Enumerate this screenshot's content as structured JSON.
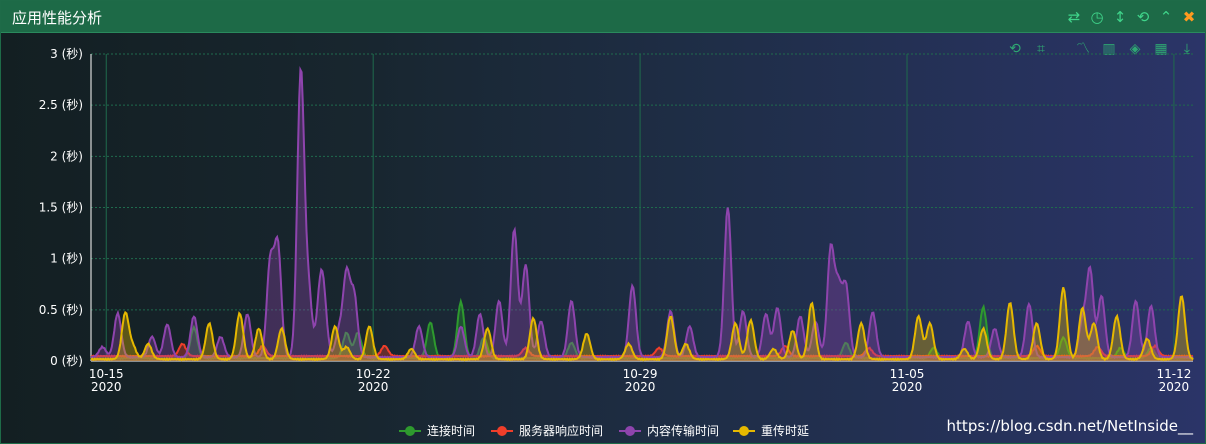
{
  "header": {
    "title": "应用性能分析"
  },
  "window_icons": [
    "swap-icon",
    "clock-icon",
    "vertical-arrows-icon",
    "refresh-icon",
    "collapse-icon",
    "close-icon"
  ],
  "toolbox_icons": [
    "zoom-reset-icon",
    "zoom-area-icon",
    "line-chart-icon",
    "bar-chart-icon",
    "stack-icon",
    "tiled-icon",
    "download-icon"
  ],
  "watermark": "https://blog.csdn.net/NetInside__",
  "chart_data": {
    "type": "area",
    "title": "",
    "x_dates": [
      "10-15\n2020",
      "10-22\n2020",
      "10-29\n2020",
      "11-05\n2020",
      "11-12\n2020"
    ],
    "x_ticks": [
      {
        "d1": "10-15",
        "d2": "2020",
        "day": 0
      },
      {
        "d1": "10-22",
        "d2": "2020",
        "day": 7
      },
      {
        "d1": "10-29",
        "d2": "2020",
        "day": 14
      },
      {
        "d1": "11-05",
        "d2": "2020",
        "day": 21
      },
      {
        "d1": "11-12",
        "d2": "2020",
        "day": 28
      }
    ],
    "x_range_days": [
      -0.4,
      28.5
    ],
    "y_ticks": [
      "0 (秒)",
      "0.5 (秒)",
      "1 (秒)",
      "1.5 (秒)",
      "2 (秒)",
      "2.5 (秒)",
      "3 (秒)"
    ],
    "ylim": [
      0,
      3
    ],
    "legend_position": "bottom",
    "series": [
      {
        "name": "连接时间",
        "color": "#2e9a2e",
        "baseline": 0.02,
        "peaks": [
          [
            2.3,
            0.3
          ],
          [
            6.3,
            0.25
          ],
          [
            6.6,
            0.25
          ],
          [
            8.5,
            0.35
          ],
          [
            9.3,
            0.55
          ],
          [
            9.9,
            0.2
          ],
          [
            12.2,
            0.15
          ],
          [
            19.4,
            0.15
          ],
          [
            21.7,
            0.1
          ],
          [
            23.0,
            0.5
          ],
          [
            25.1,
            0.2
          ],
          [
            26.6,
            0.1
          ],
          [
            27.4,
            0.1
          ]
        ]
      },
      {
        "name": "服务器响应时间",
        "color": "#f03e2a",
        "baseline": 0.04,
        "peaks": [
          [
            2.0,
            0.12
          ],
          [
            4.1,
            0.1
          ],
          [
            7.3,
            0.1
          ],
          [
            11.0,
            0.08
          ],
          [
            14.5,
            0.08
          ],
          [
            17.8,
            0.1
          ],
          [
            20.0,
            0.08
          ],
          [
            24.4,
            0.1
          ],
          [
            26.0,
            0.09
          ],
          [
            27.5,
            0.1
          ]
        ]
      },
      {
        "name": "内容传输时间",
        "color": "#8e44ad",
        "baseline": 0.03,
        "peaks": [
          [
            -0.1,
            0.1
          ],
          [
            0.3,
            0.43
          ],
          [
            1.2,
            0.2
          ],
          [
            1.6,
            0.32
          ],
          [
            2.3,
            0.4
          ],
          [
            3.0,
            0.2
          ],
          [
            3.7,
            0.42
          ],
          [
            4.3,
            0.92
          ],
          [
            4.5,
            1.08
          ],
          [
            5.1,
            2.78
          ],
          [
            5.3,
            0.65
          ],
          [
            5.6,
            0.5
          ],
          [
            5.7,
            0.5
          ],
          [
            6.1,
            0.25
          ],
          [
            6.3,
            0.8
          ],
          [
            6.5,
            0.6
          ],
          [
            8.2,
            0.3
          ],
          [
            9.3,
            0.3
          ],
          [
            9.8,
            0.42
          ],
          [
            10.3,
            0.55
          ],
          [
            10.7,
            1.25
          ],
          [
            11.0,
            0.9
          ],
          [
            11.4,
            0.35
          ],
          [
            12.2,
            0.55
          ],
          [
            13.8,
            0.7
          ],
          [
            14.8,
            0.45
          ],
          [
            15.3,
            0.3
          ],
          [
            16.3,
            1.47
          ],
          [
            16.7,
            0.45
          ],
          [
            17.3,
            0.42
          ],
          [
            17.6,
            0.48
          ],
          [
            18.2,
            0.4
          ],
          [
            18.6,
            0.35
          ],
          [
            19.0,
            1.05
          ],
          [
            19.2,
            0.65
          ],
          [
            19.4,
            0.68
          ],
          [
            20.1,
            0.44
          ],
          [
            22.6,
            0.35
          ],
          [
            23.3,
            0.28
          ],
          [
            24.2,
            0.52
          ],
          [
            25.6,
            0.35
          ],
          [
            25.8,
            0.85
          ],
          [
            26.1,
            0.6
          ],
          [
            27.0,
            0.55
          ],
          [
            27.4,
            0.5
          ]
        ]
      },
      {
        "name": "重传时延",
        "color": "#e6b800",
        "baseline": 0.01,
        "peaks": [
          [
            0.5,
            0.45
          ],
          [
            0.7,
            0.12
          ],
          [
            1.1,
            0.15
          ],
          [
            2.7,
            0.35
          ],
          [
            3.5,
            0.45
          ],
          [
            4.0,
            0.3
          ],
          [
            4.6,
            0.3
          ],
          [
            6.0,
            0.32
          ],
          [
            6.3,
            0.12
          ],
          [
            6.9,
            0.32
          ],
          [
            8.0,
            0.1
          ],
          [
            10.0,
            0.3
          ],
          [
            11.2,
            0.4
          ],
          [
            12.6,
            0.25
          ],
          [
            13.7,
            0.15
          ],
          [
            14.8,
            0.42
          ],
          [
            15.2,
            0.15
          ],
          [
            16.5,
            0.35
          ],
          [
            16.9,
            0.38
          ],
          [
            17.5,
            0.1
          ],
          [
            18.0,
            0.28
          ],
          [
            18.5,
            0.55
          ],
          [
            19.8,
            0.35
          ],
          [
            21.3,
            0.42
          ],
          [
            21.6,
            0.35
          ],
          [
            22.5,
            0.1
          ],
          [
            23.0,
            0.3
          ],
          [
            23.7,
            0.55
          ],
          [
            24.4,
            0.35
          ],
          [
            25.1,
            0.7
          ],
          [
            25.6,
            0.5
          ],
          [
            25.9,
            0.35
          ],
          [
            26.5,
            0.42
          ],
          [
            27.3,
            0.2
          ],
          [
            28.2,
            0.62
          ]
        ]
      }
    ]
  }
}
